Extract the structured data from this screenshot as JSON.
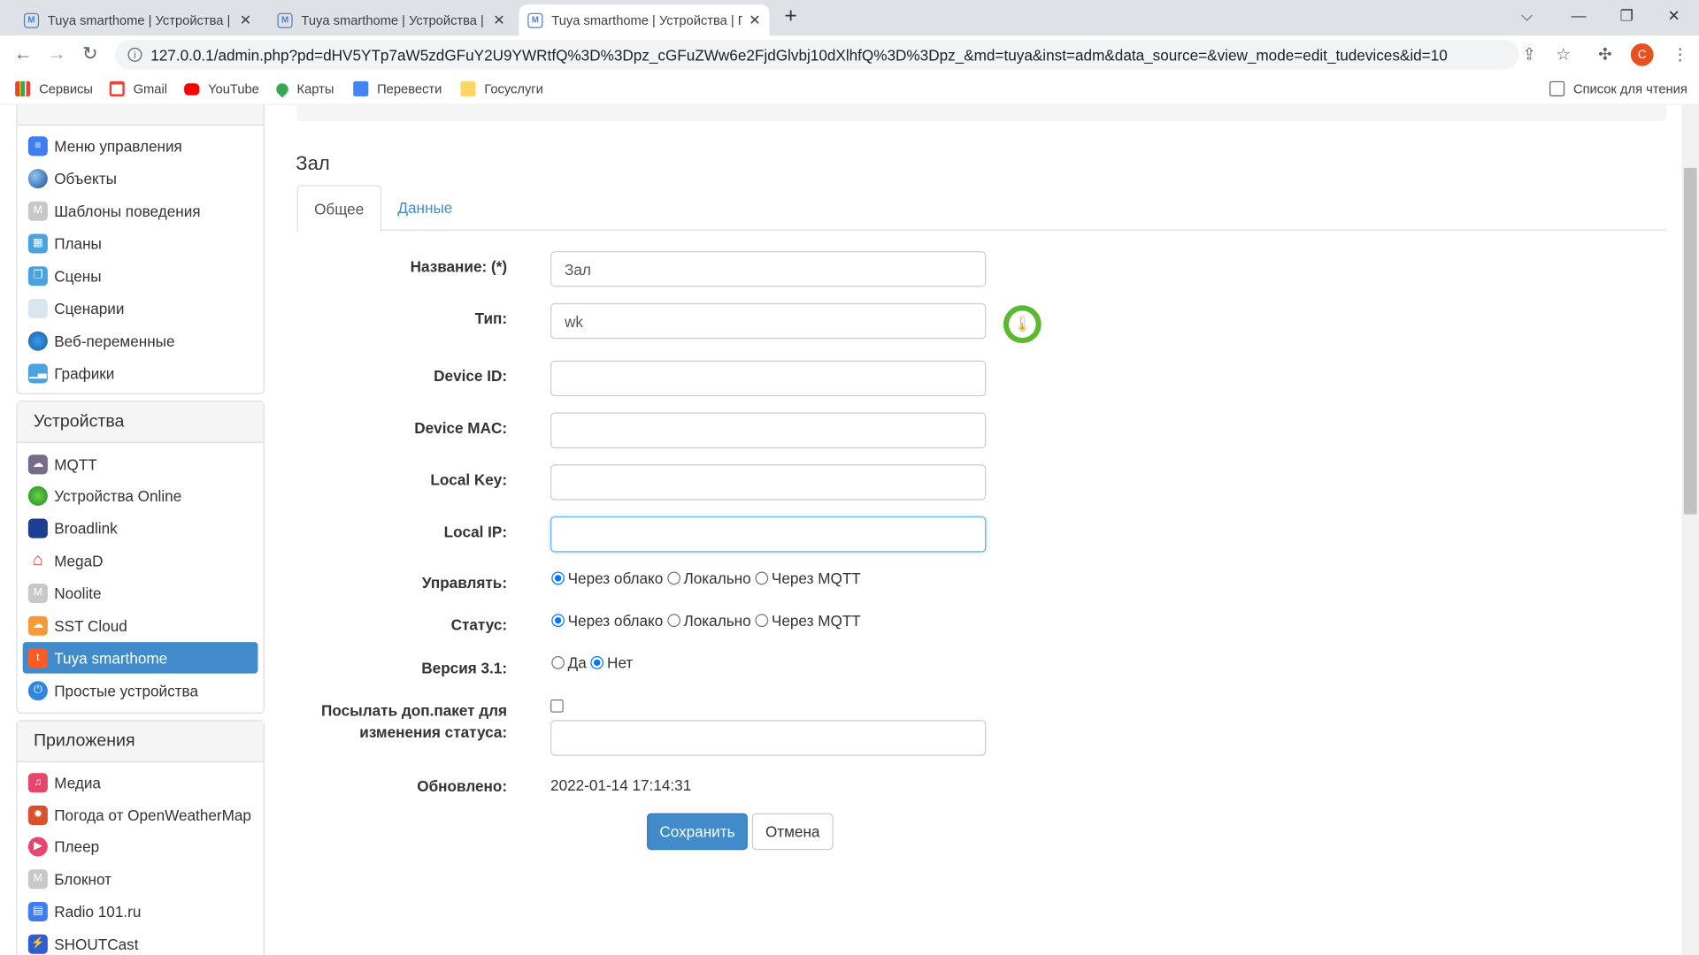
{
  "browser": {
    "tabs": [
      {
        "title": "Tuya smarthome | Устройства | Г"
      },
      {
        "title": "Tuya smarthome | Устройства | Г"
      },
      {
        "title": "Tuya smarthome | Устройства | Г"
      }
    ],
    "url": "127.0.0.1/admin.php?pd=dHV5YTp7aW5zdGFuY2U9YWRtfQ%3D%3Dpz_cGFuZWw6e2FjdGlvbj10dXlhfQ%3D%3Dpz_&md=tuya&inst=adm&data_source=&view_mode=edit_tudevices&id=10",
    "avatar_letter": "C",
    "bookmarks": [
      "Сервисы",
      "Gmail",
      "YouTube",
      "Карты",
      "Перевести",
      "Госуслуги"
    ],
    "reading_list": "Список для чтения"
  },
  "sidebar": {
    "system_items": [
      "Меню управления",
      "Объекты",
      "Шаблоны поведения",
      "Планы",
      "Сцены",
      "Сценарии",
      "Веб-переменные",
      "Графики"
    ],
    "devices_title": "Устройства",
    "devices_items": [
      "MQTT",
      "Устройства Online",
      "Broadlink",
      "MegaD",
      "Noolite",
      "SST Cloud",
      "Tuya smarthome",
      "Простые устройства"
    ],
    "apps_title": "Приложения",
    "apps_items": [
      "Медиа",
      "Погода от OpenWeatherMap",
      "Плеер",
      "Блокнот",
      "Radio 101.ru",
      "SHOUTCast"
    ]
  },
  "main": {
    "title": "Зал",
    "tabs": [
      "Общее",
      "Данные"
    ],
    "form": {
      "name_label": "Название: (*)",
      "name_value": "Зал",
      "type_label": "Тип:",
      "type_value": "wk",
      "device_id_label": "Device ID:",
      "device_id_value": "",
      "device_mac_label": "Device MAC:",
      "device_mac_value": "",
      "local_key_label": "Local Key:",
      "local_key_value": "",
      "local_ip_label": "Local IP:",
      "local_ip_value": "",
      "control_label": "Управлять:",
      "status_label": "Статус:",
      "mode_options": [
        "Через облако",
        "Локально",
        "Через MQTT"
      ],
      "control_selected": "Через облако",
      "status_selected": "Через облако",
      "version_label": "Версия 3.1:",
      "version_options": [
        "Да",
        "Нет"
      ],
      "version_selected": "Нет",
      "extra_packet_label_1": "Посылать доп.пакет для",
      "extra_packet_label_2": "изменения статуса:",
      "extra_packet_checked": false,
      "extra_packet_value": "",
      "updated_label": "Обновлено:",
      "updated_value": "2022-01-14 17:14:31",
      "save": "Сохранить",
      "cancel": "Отмена"
    }
  },
  "colors": {
    "accent": "#428bca",
    "active_item": "#428bca"
  }
}
